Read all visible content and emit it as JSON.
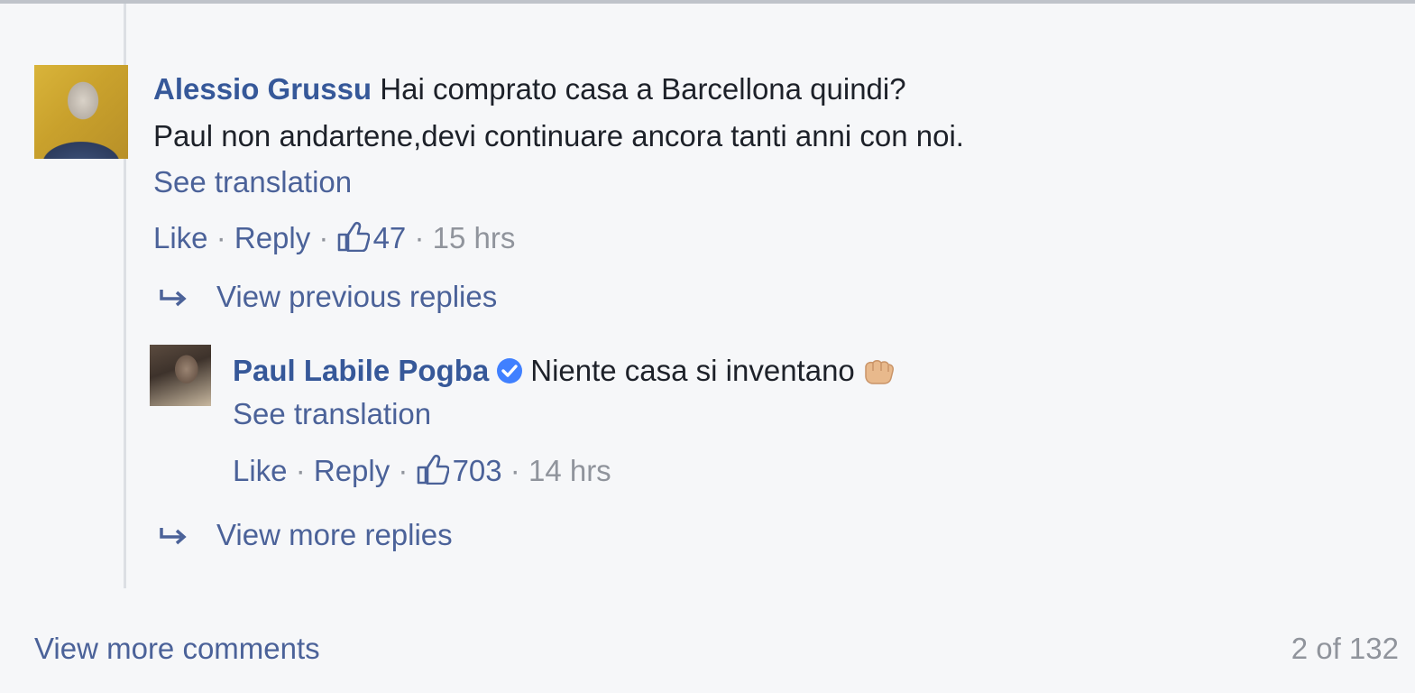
{
  "comment": {
    "author": "Alessio Grussu",
    "text_line1": "Hai comprato casa a Barcellona quindi?",
    "text_line2": "Paul non andartene,devi continuare ancora tanti anni con noi.",
    "see_translation": "See translation",
    "like_label": "Like",
    "reply_label": "Reply",
    "separator": " · ",
    "likes": "47",
    "time": "15 hrs"
  },
  "view_previous_replies": "View previous replies",
  "reply": {
    "author": "Paul Labile Pogba",
    "text": "Niente casa si inventano",
    "see_translation": "See translation",
    "like_label": "Like",
    "reply_label": "Reply",
    "likes": "703",
    "time": "14 hrs",
    "verified_icon": "verified-badge-icon",
    "emoji_icon": "fist-emoji-icon"
  },
  "view_more_replies": "View more replies",
  "footer": {
    "view_more_comments": "View more comments",
    "pager": "2 of 132"
  },
  "colors": {
    "link": "#4b6299",
    "name": "#365899",
    "meta": "#90949c",
    "background": "#f6f7f9",
    "verified": "#4080ff"
  }
}
